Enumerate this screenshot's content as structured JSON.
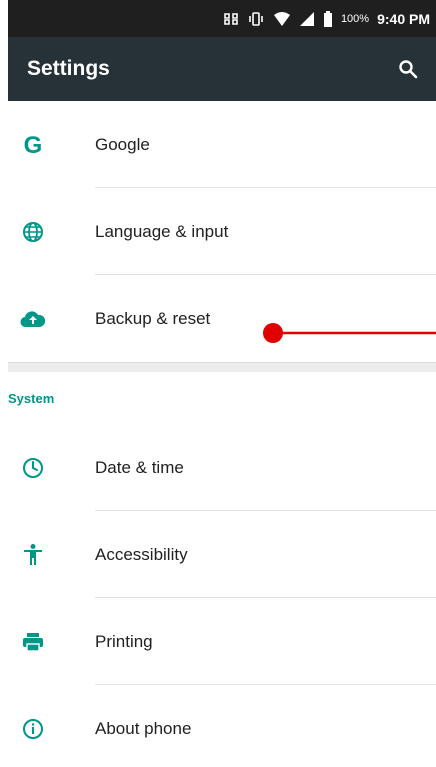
{
  "status_bar": {
    "battery_percent": "100%",
    "time": "9:40 PM",
    "icons": [
      "nfc-icon",
      "vibrate-icon",
      "wifi-icon",
      "signal-icon",
      "battery-icon"
    ]
  },
  "toolbar": {
    "title": "Settings",
    "search_icon": "search-icon"
  },
  "items_top": [
    {
      "label": "Google",
      "icon": "google-icon"
    },
    {
      "label": "Language & input",
      "icon": "globe-icon"
    },
    {
      "label": "Backup & reset",
      "icon": "cloud-upload-icon"
    }
  ],
  "section": {
    "title": "System"
  },
  "items_system": [
    {
      "label": "Date & time",
      "icon": "clock-icon"
    },
    {
      "label": "Accessibility",
      "icon": "accessibility-icon"
    },
    {
      "label": "Printing",
      "icon": "printer-icon"
    },
    {
      "label": "About phone",
      "icon": "info-icon"
    }
  ],
  "colors": {
    "accent": "#009688",
    "toolbar": "#263238",
    "status_bar": "#1f1f1f",
    "touch_marker": "#e00000"
  }
}
